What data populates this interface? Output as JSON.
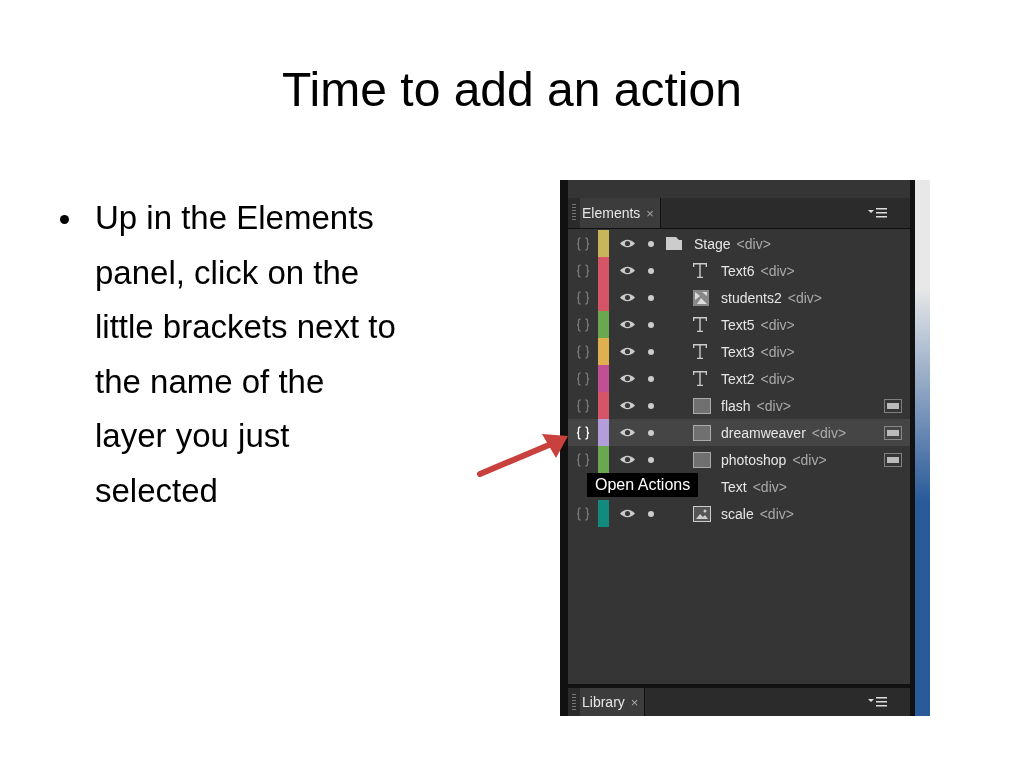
{
  "slide": {
    "title": "Time to add an action",
    "bullets": [
      "Up in the Elements panel, click on the little brackets next to the name of the layer you just selected"
    ]
  },
  "panel": {
    "tab": {
      "label": "Elements",
      "close": "×"
    },
    "elements": [
      {
        "name": "Stage",
        "tag": "<div>",
        "kind": "stage",
        "color": "#c9b55a",
        "selected": false,
        "clipped": false,
        "children": [
          {
            "name": "Text6",
            "tag": "<div>",
            "kind": "text",
            "color": "#d55566",
            "selected": false,
            "clipped": false
          },
          {
            "name": "students2",
            "tag": "<div>",
            "kind": "sequence",
            "color": "#d55566",
            "selected": false,
            "clipped": false
          },
          {
            "name": "Text5",
            "tag": "<div>",
            "kind": "text",
            "color": "#6aa84f",
            "selected": false,
            "clipped": false
          },
          {
            "name": "Text3",
            "tag": "<div>",
            "kind": "text",
            "color": "#e0b050",
            "selected": false,
            "clipped": false
          },
          {
            "name": "Text2",
            "tag": "<div>",
            "kind": "text",
            "color": "#c04f94",
            "selected": false,
            "clipped": false
          },
          {
            "name": "flash",
            "tag": "<div>",
            "kind": "rectangle",
            "color": "#d55566",
            "selected": false,
            "clipped": true
          },
          {
            "name": "dreamweaver",
            "tag": "<div>",
            "kind": "rectangle",
            "color": "#b39ddb",
            "selected": true,
            "clipped": true
          },
          {
            "name": "photoshop",
            "tag": "<div>",
            "kind": "rectangle",
            "color": "#6aa84f",
            "selected": false,
            "clipped": true
          },
          {
            "name": "Text",
            "tag": "<div>",
            "kind": "text",
            "selected": false,
            "clipped": false
          },
          {
            "name": "scale",
            "tag": "<div>",
            "kind": "image",
            "color": "#138a7e",
            "selected": false,
            "clipped": false
          }
        ]
      }
    ],
    "tooltip": "Open Actions",
    "library_tab": {
      "label": "Library",
      "close": "×"
    }
  }
}
